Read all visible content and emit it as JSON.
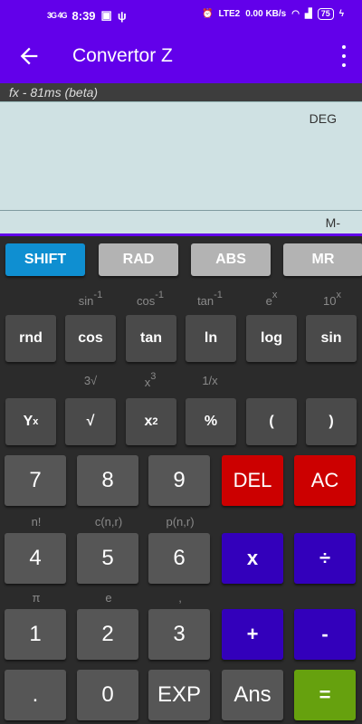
{
  "statusbar": {
    "time": "8:39",
    "network": "3G 4G",
    "lte": "LTE2",
    "speed": "0.00 KB/s",
    "battery": "75"
  },
  "appbar": {
    "title": "Convertor Z"
  },
  "status_line": "fx - 81ms (beta)",
  "display": {
    "angle_mode": "DEG",
    "memory": "M-"
  },
  "mode_row": [
    "SHIFT",
    "RAD",
    "ABS",
    "MR"
  ],
  "secondary_row1": [
    "sin-1",
    "cos-1",
    "tan-1",
    "ex",
    "10x"
  ],
  "fn_row1": [
    "rnd",
    "cos",
    "tan",
    "ln",
    "log",
    "sin"
  ],
  "secondary_row2": [
    "3√",
    "x3",
    "1/x"
  ],
  "fn_row2": [
    "Yx",
    "√",
    "x2",
    "%",
    "(",
    ")"
  ],
  "row3": [
    "7",
    "8",
    "9",
    "DEL",
    "AC"
  ],
  "secondary_row3": [
    "n!",
    "c(n,r)",
    "p(n,r)"
  ],
  "row4": [
    "4",
    "5",
    "6",
    "x",
    "÷"
  ],
  "secondary_row4": [
    "π",
    "e",
    ","
  ],
  "row5": [
    "1",
    "2",
    "3",
    "+",
    "-"
  ],
  "row6": [
    ".",
    "0",
    "EXP",
    "Ans",
    "="
  ],
  "colors": {
    "accent": "#6200ea",
    "shift": "#0f8fd1",
    "del": "#cc0000",
    "operator": "#3300bb",
    "equals": "#66a10e"
  }
}
